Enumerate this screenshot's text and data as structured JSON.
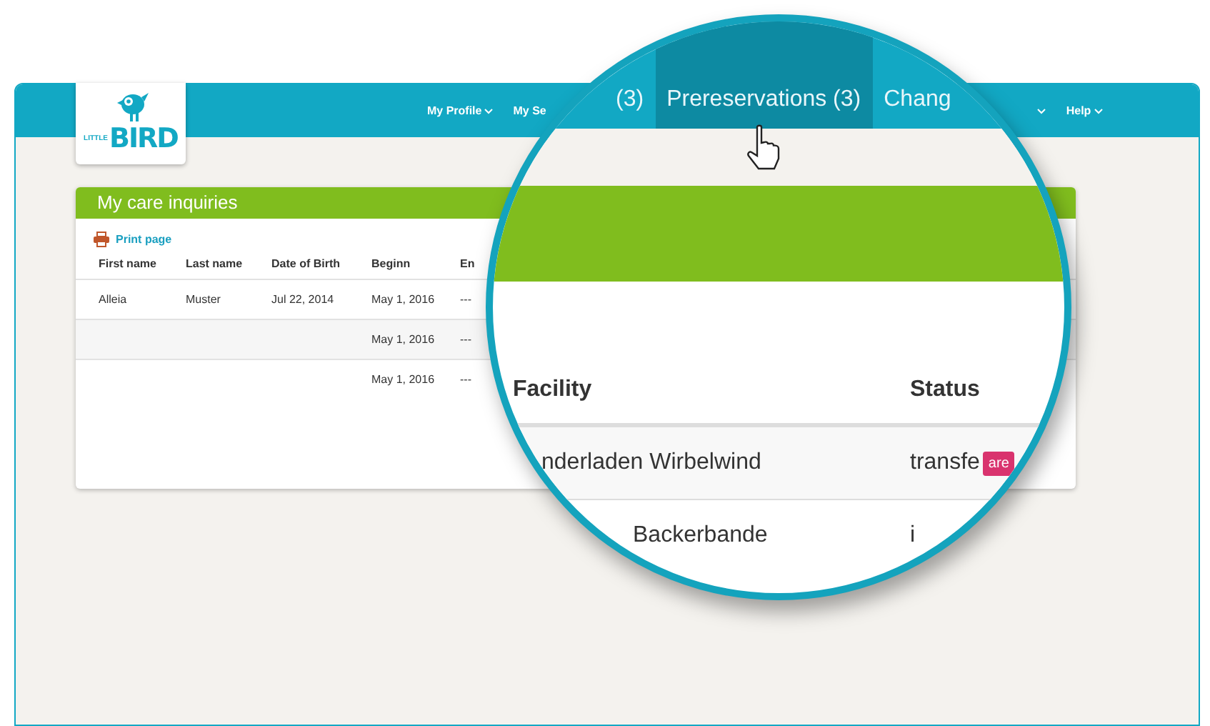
{
  "logo": {
    "wordmark": "BIRD",
    "tagline": "LITTLE"
  },
  "nav": [
    {
      "label": "My Profile",
      "dropdown": true
    },
    {
      "label": "My Se",
      "dropdown": false
    },
    {
      "dropdown": true
    },
    {
      "label": "Help",
      "dropdown": true
    }
  ],
  "card": {
    "title": "My care inquiries",
    "print_link": "Print page",
    "columns": [
      "First name",
      "Last name",
      "Date of Birth",
      "Beginn",
      "En"
    ],
    "rows": [
      {
        "first_name": "Alleia",
        "last_name": "Muster",
        "date_of_birth": "Jul 22, 2014",
        "beginn": "May 1, 2016",
        "end": "---"
      },
      {
        "beginn": "May 1, 2016",
        "end": "---"
      },
      {
        "beginn": "May 1, 2016",
        "end": "---"
      }
    ]
  },
  "magnifier": {
    "tabs": [
      {
        "label": "(3)",
        "selected": false
      },
      {
        "label": "Prereservations (3)",
        "selected": true
      },
      {
        "label": "Chang",
        "selected": false
      }
    ],
    "columns": [
      "Facility",
      "Status"
    ],
    "rows": [
      {
        "facility": "nderladen Wirbelwind",
        "status": "transfe",
        "badge": "are"
      },
      {
        "facility": "Backerbande",
        "status": "i"
      }
    ]
  }
}
